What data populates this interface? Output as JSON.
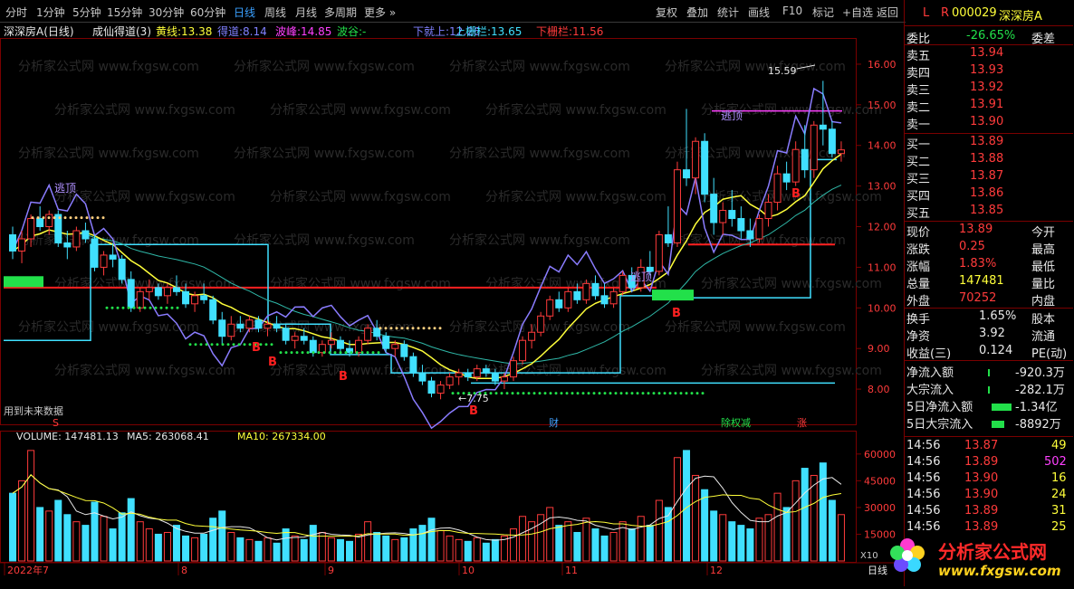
{
  "toolbar": {
    "periods": [
      "分时",
      "1分钟",
      "5分钟",
      "15分钟",
      "30分钟",
      "60分钟",
      "日线",
      "周线",
      "月线",
      "多周期",
      "更多"
    ],
    "selected": "日线",
    "tools": [
      "复权",
      "叠加",
      "统计",
      "画线",
      "F10",
      "标记",
      "+自选",
      "返回"
    ]
  },
  "header": {
    "stock": "深深房A(日线)",
    "indicator": "成仙得道(3)",
    "items": [
      {
        "label": "黄线:",
        "value": "13.38",
        "color": "#ffff3a"
      },
      {
        "label": "得道:",
        "value": "8.14",
        "color": "#8080ff"
      },
      {
        "label": "波峰:",
        "value": "14.85",
        "color": "#ff40ff"
      },
      {
        "label": "波谷:",
        "value": "-",
        "color": "#22e04a"
      },
      {
        "label": "下就上:",
        "value": "12.26",
        "color": "#8080ff"
      },
      {
        "label": "上栅栏:",
        "value": "13.65",
        "color": "#40e0ff"
      },
      {
        "label": "下栅栏:",
        "value": "11.56",
        "color": "#ff3b3b"
      }
    ]
  },
  "annotations": {
    "peak_label": "15.59",
    "low_label": "7.75",
    "escape_top": "逃顶",
    "buy_mark": "B",
    "future_data_note": "用到未来数据",
    "event_marks": [
      "S",
      "财",
      "除权减",
      "涨"
    ],
    "watermark": "分析家公式网 www.fxgsw.com"
  },
  "volume_header": {
    "volume": "VOLUME: 147481.13",
    "ma5": "MA5: 263068.41",
    "ma10": "MA10: 267334.00"
  },
  "chart_data": {
    "type": "candlestick",
    "price_axis": {
      "ticks": [
        "16.00",
        "15.00",
        "14.00",
        "13.00",
        "12.00",
        "11.00",
        "10.00",
        "9.00",
        "8.00"
      ],
      "ylim": [
        7.2,
        16.6
      ]
    },
    "volume_axis": {
      "ticks": [
        "60000",
        "45000",
        "30000",
        "15000"
      ],
      "unit": "X10"
    },
    "x_labels": [
      "2022年7",
      "8",
      "9",
      "10",
      "11",
      "12"
    ],
    "period_label": "日线",
    "levels": {
      "red_line_1": 10.5,
      "red_line_2": 11.56,
      "cyan_line": 8.15,
      "peak": 14.85
    },
    "candles": [
      [
        11.8,
        12.0,
        11.2,
        11.4
      ],
      [
        11.4,
        11.9,
        11.1,
        11.7
      ],
      [
        11.7,
        12.3,
        11.5,
        12.2
      ],
      [
        12.2,
        12.5,
        11.9,
        12.0
      ],
      [
        12.0,
        12.4,
        11.8,
        12.3
      ],
      [
        12.3,
        12.4,
        11.5,
        11.6
      ],
      [
        11.6,
        11.9,
        11.2,
        11.5
      ],
      [
        11.5,
        12.0,
        11.4,
        11.9
      ],
      [
        11.9,
        12.1,
        11.6,
        11.7
      ],
      [
        11.7,
        11.8,
        10.9,
        11.0
      ],
      [
        11.0,
        11.4,
        10.8,
        11.3
      ],
      [
        11.3,
        11.6,
        11.0,
        11.2
      ],
      [
        11.2,
        11.3,
        10.6,
        10.7
      ],
      [
        10.7,
        10.9,
        9.9,
        10.0
      ],
      [
        10.0,
        10.5,
        9.9,
        10.4
      ],
      [
        10.4,
        10.7,
        10.2,
        10.5
      ],
      [
        10.5,
        10.6,
        10.2,
        10.3
      ],
      [
        10.3,
        10.6,
        10.1,
        10.5
      ],
      [
        10.5,
        10.8,
        10.3,
        10.4
      ],
      [
        10.4,
        10.6,
        10.0,
        10.1
      ],
      [
        10.1,
        10.4,
        9.9,
        10.3
      ],
      [
        10.3,
        10.6,
        10.1,
        10.2
      ],
      [
        10.2,
        10.3,
        9.6,
        9.7
      ],
      [
        9.7,
        9.9,
        9.1,
        9.3
      ],
      [
        9.3,
        9.8,
        9.2,
        9.6
      ],
      [
        9.6,
        9.8,
        9.4,
        9.5
      ],
      [
        9.5,
        9.8,
        9.4,
        9.7
      ],
      [
        9.7,
        9.8,
        9.4,
        9.5
      ],
      [
        9.5,
        9.7,
        9.3,
        9.6
      ],
      [
        9.6,
        9.8,
        9.4,
        9.5
      ],
      [
        9.5,
        9.6,
        9.1,
        9.2
      ],
      [
        9.2,
        9.4,
        9.0,
        9.3
      ],
      [
        9.3,
        9.5,
        9.1,
        9.2
      ],
      [
        9.2,
        9.3,
        8.8,
        8.9
      ],
      [
        8.9,
        9.2,
        8.8,
        9.1
      ],
      [
        9.1,
        9.4,
        9.0,
        9.2
      ],
      [
        9.2,
        9.3,
        8.9,
        9.0
      ],
      [
        9.0,
        9.2,
        8.8,
        8.9
      ],
      [
        8.9,
        9.3,
        8.8,
        9.2
      ],
      [
        9.2,
        9.6,
        9.1,
        9.5
      ],
      [
        9.5,
        9.7,
        9.2,
        9.3
      ],
      [
        9.3,
        9.4,
        8.9,
        9.0
      ],
      [
        9.0,
        9.2,
        8.8,
        9.1
      ],
      [
        9.1,
        9.2,
        8.7,
        8.8
      ],
      [
        8.8,
        8.9,
        8.3,
        8.4
      ],
      [
        8.4,
        8.6,
        8.1,
        8.2
      ],
      [
        8.2,
        8.3,
        7.8,
        7.9
      ],
      [
        7.9,
        8.2,
        7.75,
        8.1
      ],
      [
        8.1,
        8.4,
        8.0,
        8.3
      ],
      [
        8.3,
        8.5,
        8.1,
        8.4
      ],
      [
        8.4,
        8.5,
        8.2,
        8.3
      ],
      [
        8.3,
        8.6,
        8.2,
        8.5
      ],
      [
        8.5,
        8.6,
        8.3,
        8.4
      ],
      [
        8.4,
        8.5,
        8.1,
        8.2
      ],
      [
        8.2,
        8.4,
        8.0,
        8.3
      ],
      [
        8.3,
        8.8,
        8.2,
        8.7
      ],
      [
        8.7,
        9.3,
        8.6,
        9.2
      ],
      [
        9.2,
        9.6,
        9.0,
        9.4
      ],
      [
        9.4,
        9.9,
        9.3,
        9.8
      ],
      [
        9.8,
        10.3,
        9.7,
        10.2
      ],
      [
        10.2,
        10.4,
        9.9,
        10.0
      ],
      [
        10.0,
        10.5,
        9.9,
        10.4
      ],
      [
        10.4,
        10.6,
        10.1,
        10.2
      ],
      [
        10.2,
        10.7,
        10.1,
        10.6
      ],
      [
        10.6,
        10.8,
        10.2,
        10.3
      ],
      [
        10.3,
        10.6,
        10.0,
        10.1
      ],
      [
        10.1,
        10.5,
        10.0,
        10.4
      ],
      [
        10.4,
        10.9,
        10.3,
        10.8
      ],
      [
        10.8,
        11.0,
        10.4,
        10.5
      ],
      [
        10.5,
        11.2,
        10.4,
        11.0
      ],
      [
        11.0,
        11.4,
        10.8,
        10.9
      ],
      [
        10.9,
        11.9,
        10.8,
        11.8
      ],
      [
        11.8,
        12.5,
        11.5,
        11.6
      ],
      [
        11.6,
        13.6,
        11.5,
        13.4
      ],
      [
        13.4,
        14.9,
        13.0,
        13.2
      ],
      [
        13.2,
        14.2,
        12.8,
        14.1
      ],
      [
        14.1,
        14.3,
        12.6,
        12.8
      ],
      [
        12.8,
        13.2,
        11.8,
        12.1
      ],
      [
        12.1,
        12.6,
        11.8,
        12.4
      ],
      [
        12.4,
        12.9,
        12.0,
        12.2
      ],
      [
        12.2,
        12.5,
        11.7,
        11.9
      ],
      [
        11.9,
        12.2,
        11.5,
        11.7
      ],
      [
        11.7,
        12.3,
        11.6,
        12.2
      ],
      [
        12.2,
        12.8,
        12.0,
        12.6
      ],
      [
        12.6,
        13.5,
        12.4,
        13.3
      ],
      [
        13.3,
        13.6,
        12.9,
        13.1
      ],
      [
        13.1,
        14.1,
        13.0,
        13.9
      ],
      [
        13.9,
        14.5,
        13.2,
        13.4
      ],
      [
        13.4,
        14.6,
        13.2,
        14.5
      ],
      [
        14.5,
        15.59,
        14.0,
        14.4
      ],
      [
        14.4,
        14.6,
        13.7,
        13.8
      ],
      [
        13.8,
        14.1,
        13.6,
        13.89
      ]
    ],
    "volumes": [
      38,
      45,
      62,
      30,
      28,
      34,
      26,
      22,
      20,
      33,
      25,
      18,
      27,
      35,
      22,
      18,
      15,
      16,
      20,
      14,
      13,
      15,
      24,
      28,
      16,
      13,
      12,
      11,
      13,
      10,
      18,
      14,
      12,
      20,
      16,
      13,
      12,
      11,
      15,
      22,
      16,
      14,
      12,
      13,
      18,
      20,
      24,
      17,
      14,
      12,
      11,
      13,
      10,
      12,
      14,
      18,
      25,
      22,
      26,
      30,
      20,
      22,
      16,
      24,
      18,
      14,
      16,
      22,
      18,
      25,
      20,
      34,
      30,
      58,
      62,
      48,
      40,
      28,
      26,
      22,
      20,
      18,
      24,
      26,
      38,
      30,
      45,
      52,
      48,
      55,
      34,
      26
    ],
    "ma5_line_note": "white",
    "ma10_line_note": "yellow"
  },
  "quote_panel": {
    "code": "000029",
    "name": "深深房A",
    "webi": {
      "label": "委比",
      "value": "-26.65%",
      "label2": "委差"
    },
    "asks": [
      [
        "卖五",
        "13.94"
      ],
      [
        "卖四",
        "13.93"
      ],
      [
        "卖三",
        "13.92"
      ],
      [
        "卖二",
        "13.91"
      ],
      [
        "卖一",
        "13.90"
      ]
    ],
    "bids": [
      [
        "买一",
        "13.89"
      ],
      [
        "买二",
        "13.88"
      ],
      [
        "买三",
        "13.87"
      ],
      [
        "买四",
        "13.86"
      ],
      [
        "买五",
        "13.85"
      ]
    ],
    "stats": [
      [
        "现价",
        "13.89",
        "今开"
      ],
      [
        "涨跌",
        "0.25",
        "最高"
      ],
      [
        "涨幅",
        "1.83%",
        "最低"
      ],
      [
        "总量",
        "147481",
        "量比"
      ],
      [
        "外盘",
        "70252",
        "内盘"
      ]
    ],
    "stats2": [
      [
        "换手",
        "1.65%",
        "股本"
      ],
      [
        "净资",
        "3.92",
        "流通"
      ],
      [
        "收益(三)",
        "0.124",
        "PE(动)"
      ]
    ],
    "flows": [
      [
        "净流入额",
        "-920.3万"
      ],
      [
        "大宗流入",
        "-282.1万"
      ],
      [
        "5日净流入额",
        "-1.34亿"
      ],
      [
        "5日大宗流入",
        "-8892万"
      ]
    ],
    "ticks": [
      [
        "14:56",
        "13.87",
        "49"
      ],
      [
        "14:56",
        "13.89",
        "502"
      ],
      [
        "14:56",
        "13.90",
        "16"
      ],
      [
        "14:56",
        "13.90",
        "24"
      ],
      [
        "14:56",
        "13.89",
        "31"
      ],
      [
        "14:56",
        "13.89",
        "25"
      ]
    ],
    "logo_text": "分析家公式网",
    "logo_url": "www.fxgsw.com"
  }
}
